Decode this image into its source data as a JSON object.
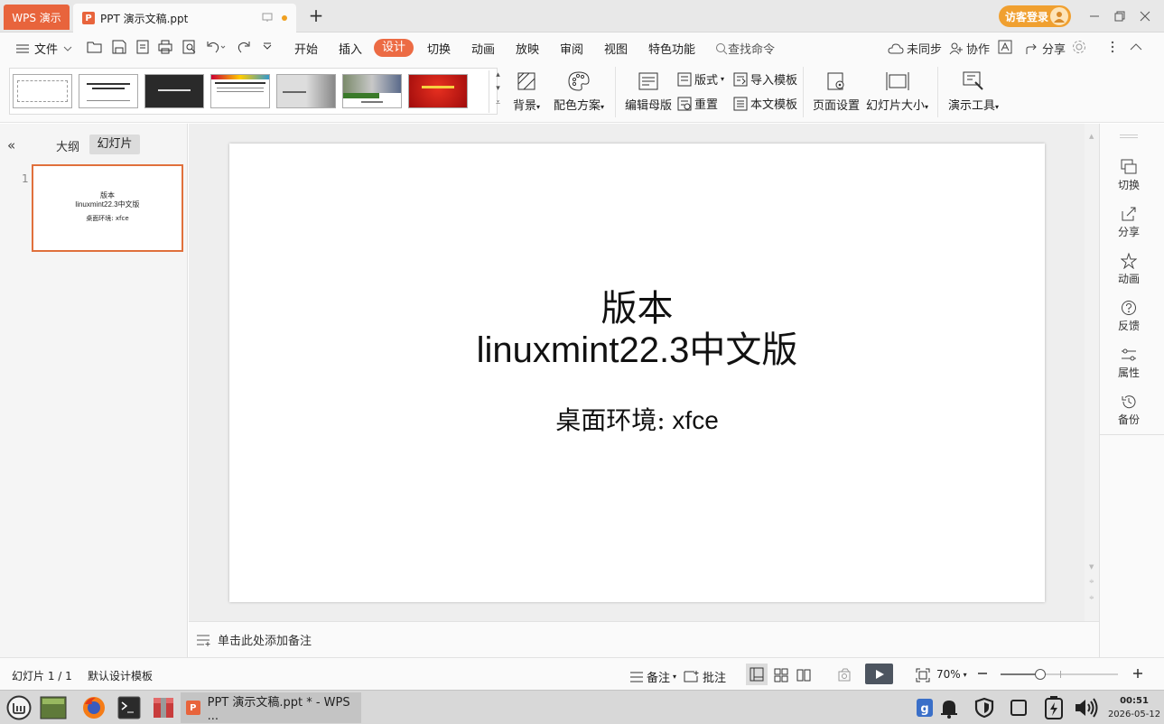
{
  "titlebar": {
    "app_tab": "WPS 演示",
    "doc_tab": "PPT 演示文稿.ppt",
    "login_label": "访客登录"
  },
  "menubar": {
    "file_label": "文件",
    "tabs": [
      "开始",
      "插入",
      "设计",
      "切换",
      "动画",
      "放映",
      "审阅",
      "视图",
      "特色功能"
    ],
    "active_tab": "设计",
    "search_label": "查找命令",
    "sync_label": "未同步",
    "collab_label": "协作",
    "share_label": "分享"
  },
  "ribbon": {
    "background": "背景",
    "color_scheme": "配色方案",
    "edit_master": "编辑母版",
    "layout": "版式",
    "reset": "重置",
    "import_template": "导入模板",
    "text_template": "本文模板",
    "page_setup": "页面设置",
    "slide_size": "幻灯片大小",
    "presentation_tools": "演示工具"
  },
  "leftpanel": {
    "outline_tab": "大纲",
    "slides_tab": "幻灯片",
    "slide_number": "1"
  },
  "slide": {
    "title_line1": "版本",
    "title_line2_latin": "linuxmint22.3",
    "title_line2_cjk": "中文版",
    "subtitle_cjk": "桌面环境:",
    "subtitle_latin": " xfce"
  },
  "notes": {
    "placeholder": "单击此处添加备注"
  },
  "rightbar": {
    "items": [
      "切换",
      "分享",
      "动画",
      "反馈",
      "属性",
      "备份"
    ]
  },
  "statusbar": {
    "slide_counter": "幻灯片 1 / 1",
    "template_name": "默认设计模板",
    "notes_label": "备注",
    "comment_label": "批注",
    "zoom": "70%"
  },
  "taskbar": {
    "wps_task": "PPT 演示文稿.ppt * - WPS ...",
    "time": "00:51",
    "date": "2026-05-12"
  },
  "colors": {
    "accent": "#e8643c",
    "login": "#f0a030",
    "slide_border": "#e0703c"
  }
}
